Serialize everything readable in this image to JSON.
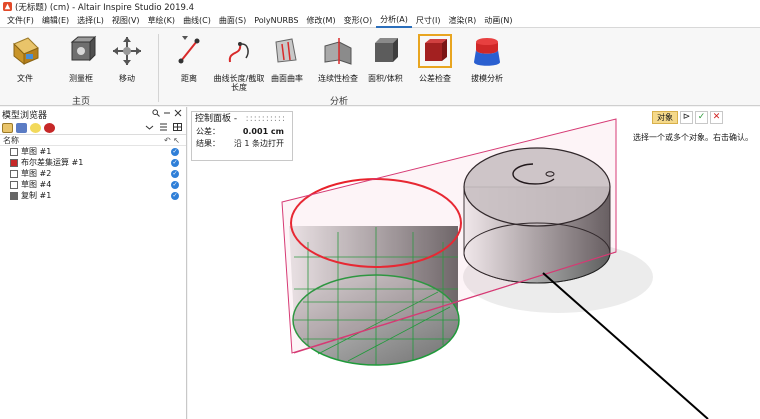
{
  "titlebar": {
    "title": "(无标题) (cm) - Altair Inspire Studio 2019.4"
  },
  "menu": {
    "items": [
      "文件(F)",
      "编辑(E)",
      "选择(L)",
      "视图(V)",
      "草绘(K)",
      "曲线(C)",
      "曲面(S)",
      "PolyNURBS",
      "修改(M)",
      "变形(O)",
      "分析(A)",
      "尺寸(I)",
      "渲染(R)",
      "动画(N)"
    ],
    "active_index": 10
  },
  "ribbon": {
    "buttons": [
      {
        "label": "文件",
        "icon": "file-icon"
      },
      {
        "label": "测量框",
        "icon": "measure-box-icon"
      },
      {
        "label": "移动",
        "icon": "move-icon"
      },
      {
        "label": "距离",
        "icon": "distance-icon"
      },
      {
        "label": "曲线长度/截取长度",
        "icon": "curve-length-icon"
      },
      {
        "label": "曲面曲率",
        "icon": "surface-curvature-icon"
      },
      {
        "label": "连续性检查",
        "icon": "continuity-check-icon"
      },
      {
        "label": "面积/体积",
        "icon": "area-volume-icon"
      },
      {
        "label": "公差检查",
        "icon": "tolerance-check-icon"
      },
      {
        "label": "拔模分析",
        "icon": "draft-analysis-icon"
      }
    ],
    "groups": {
      "home": "主页",
      "analysis": "分析"
    }
  },
  "browser": {
    "title": "模型浏览器",
    "column_header": "名称",
    "items": [
      {
        "label": "草图 #1",
        "icon": "sketch-icon"
      },
      {
        "label": "布尔差集运算 #1",
        "icon": "boolean-icon"
      },
      {
        "label": "草图 #2",
        "icon": "sketch-icon"
      },
      {
        "label": "草图 #4",
        "icon": "sketch-icon"
      },
      {
        "label": "复制 #1",
        "icon": "copy-icon"
      }
    ]
  },
  "control_panel": {
    "title": "控制面板 -",
    "tolerance_label": "公差：",
    "tolerance_value": "0.001 cm",
    "result_label": "结果：",
    "result_value": "沿 1 条边打开"
  },
  "selection": {
    "object_label": "对象",
    "hint": "选择一个或多个对象。右击确认。"
  },
  "colors": {
    "accent": "#2a6ebb",
    "edge_red": "#e8222b",
    "edge_green": "#1f9a3a",
    "plane": "#d63a74"
  }
}
